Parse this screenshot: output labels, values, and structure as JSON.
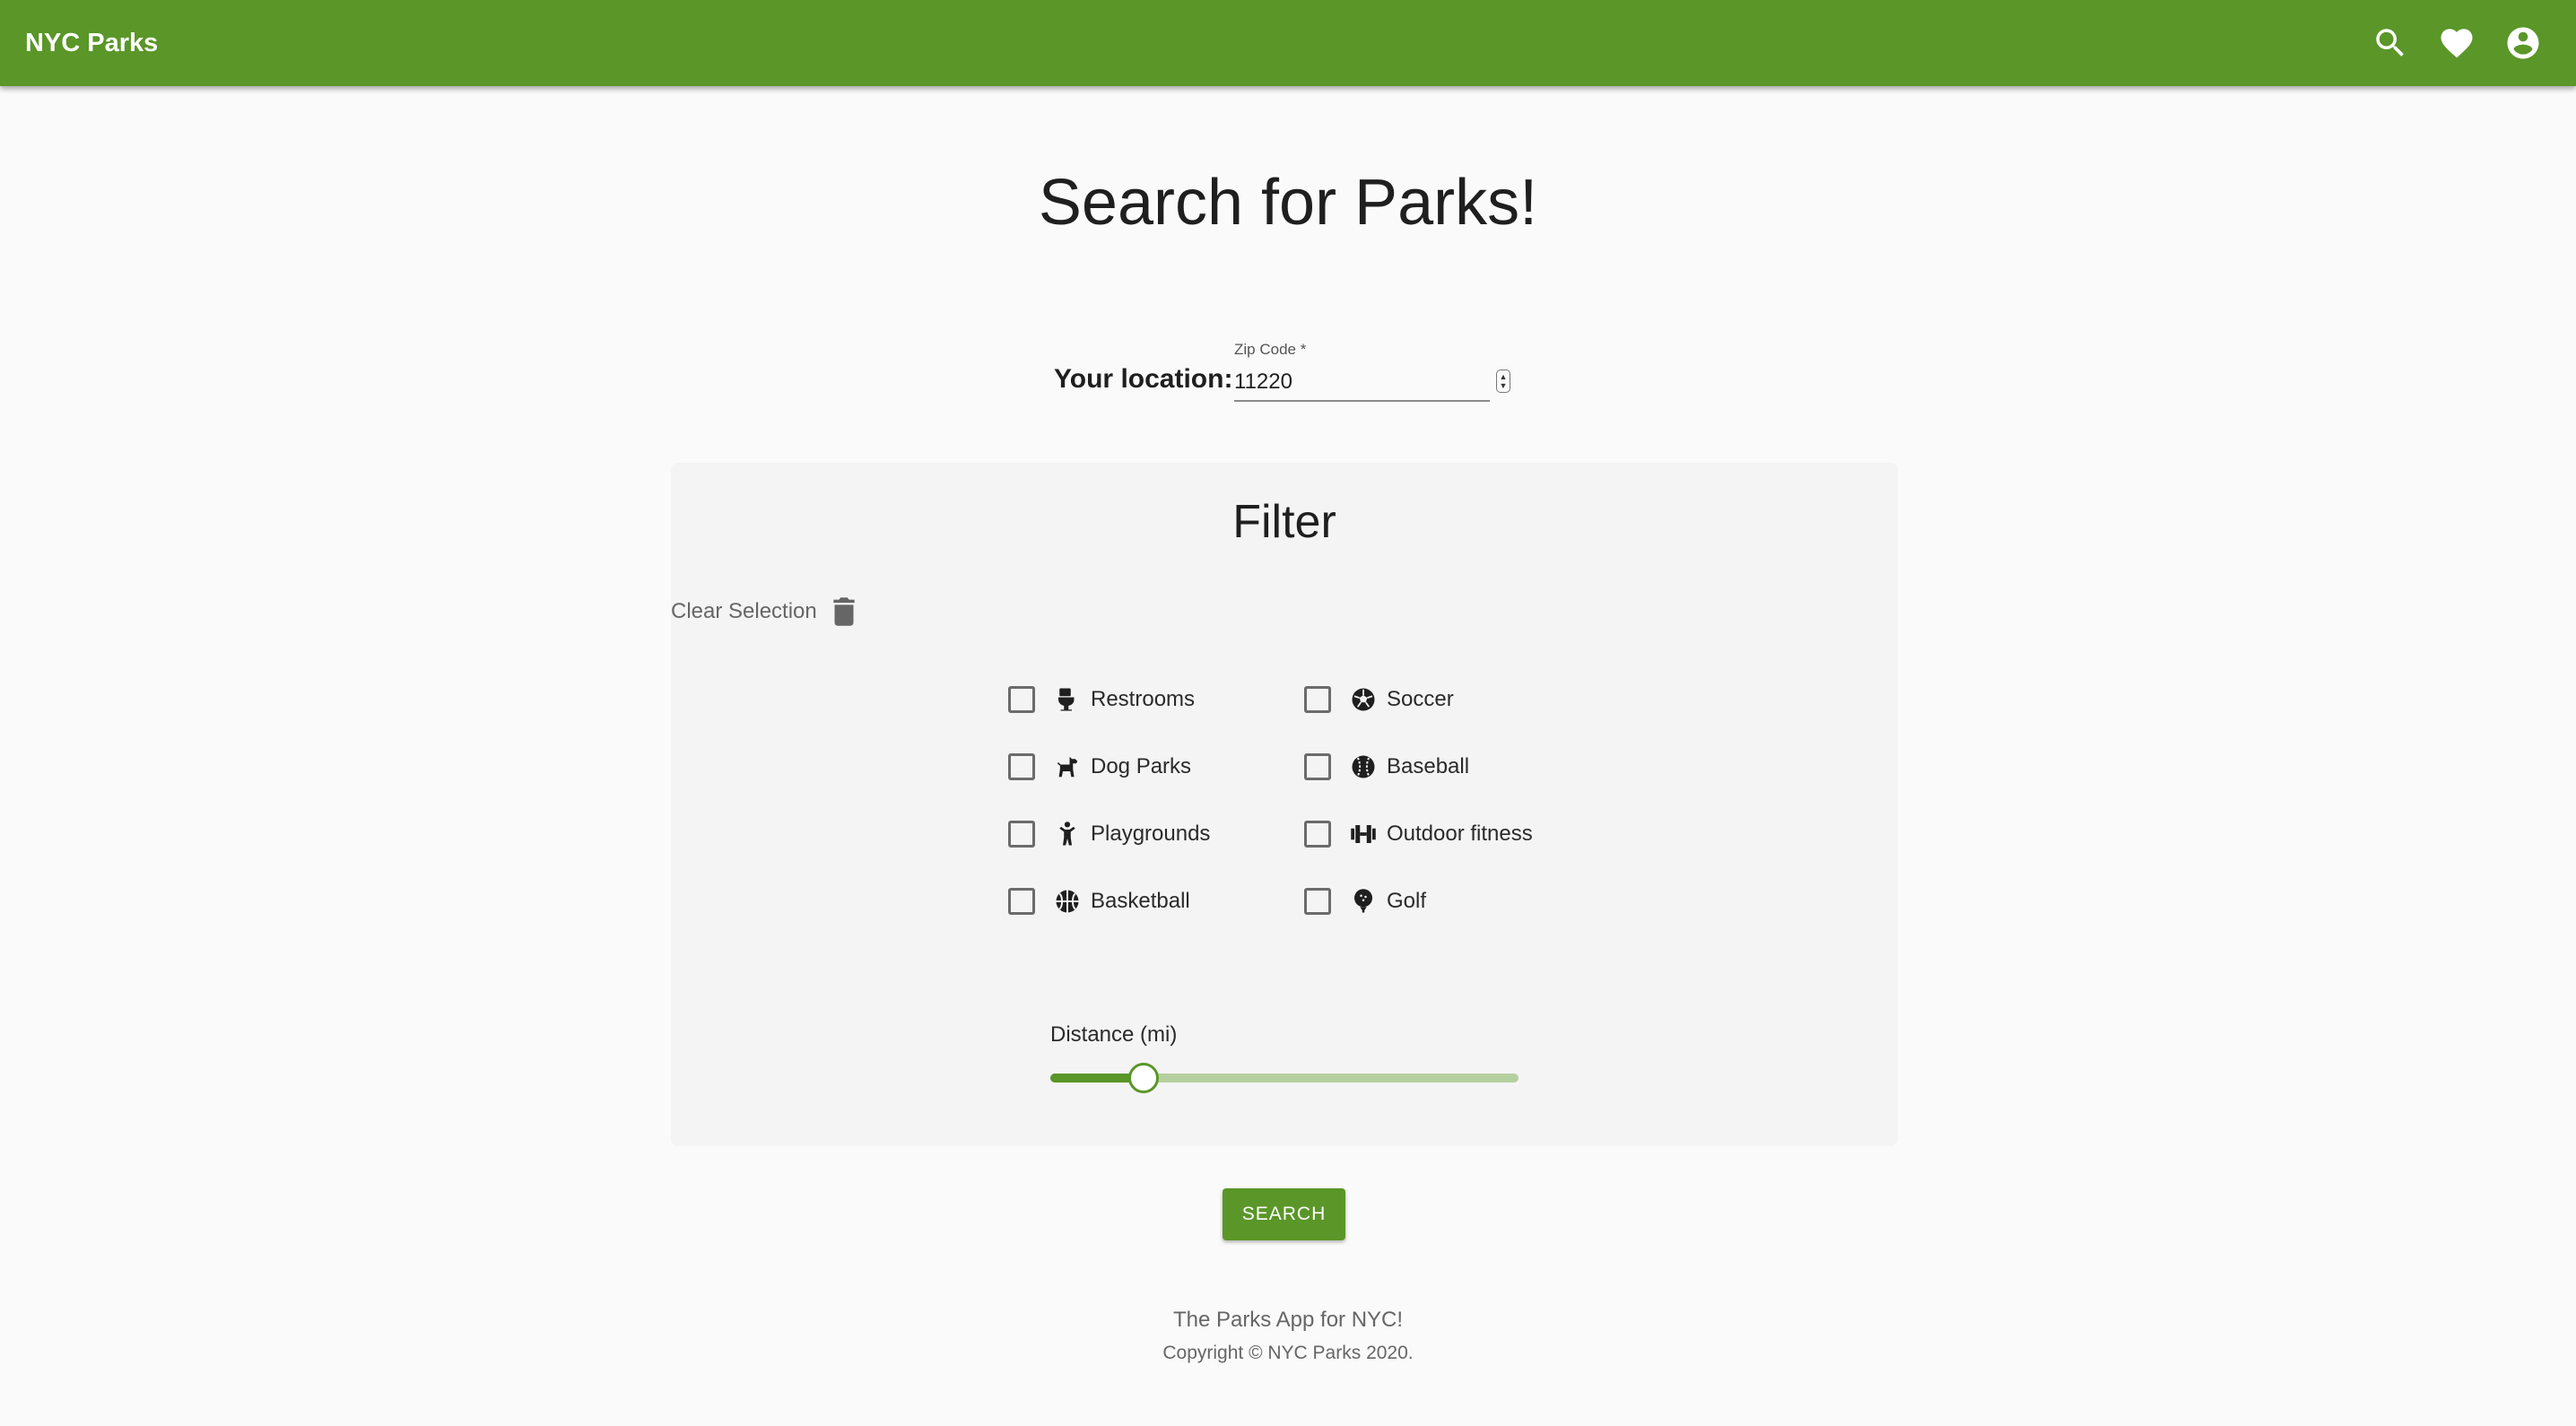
{
  "header": {
    "title": "NYC Parks",
    "icons": [
      "search-icon",
      "heart-icon",
      "account-circle-icon"
    ],
    "background_color": "#5a9628"
  },
  "main": {
    "title": "Search for Parks!",
    "location": {
      "label": "Your location:",
      "zip_label": "Zip Code *",
      "zip_value": "11220"
    }
  },
  "filter": {
    "title": "Filter",
    "clear_label": "Clear Selection",
    "clear_icon": "trash-icon",
    "options": [
      {
        "label": "Restrooms",
        "icon": "toilet-icon",
        "checked": false
      },
      {
        "label": "Dog Parks",
        "icon": "dog-icon",
        "checked": false
      },
      {
        "label": "Playgrounds",
        "icon": "child-icon",
        "checked": false
      },
      {
        "label": "Basketball",
        "icon": "basketball-icon",
        "checked": false
      },
      {
        "label": "Soccer",
        "icon": "soccer-ball-icon",
        "checked": false
      },
      {
        "label": "Baseball",
        "icon": "baseball-icon",
        "checked": false
      },
      {
        "label": "Outdoor fitness",
        "icon": "dumbbell-icon",
        "checked": false
      },
      {
        "label": "Golf",
        "icon": "golf-ball-icon",
        "checked": false
      }
    ],
    "distance": {
      "label": "Distance (mi)",
      "fraction": 0.2
    }
  },
  "actions": {
    "search_label": "SEARCH"
  },
  "footer": {
    "line1": "The Parks App for NYC!",
    "line2": "Copyright © NYC Parks 2020."
  },
  "colors": {
    "accent": "#5a9628",
    "slider_rail": "#b5d0a0"
  }
}
